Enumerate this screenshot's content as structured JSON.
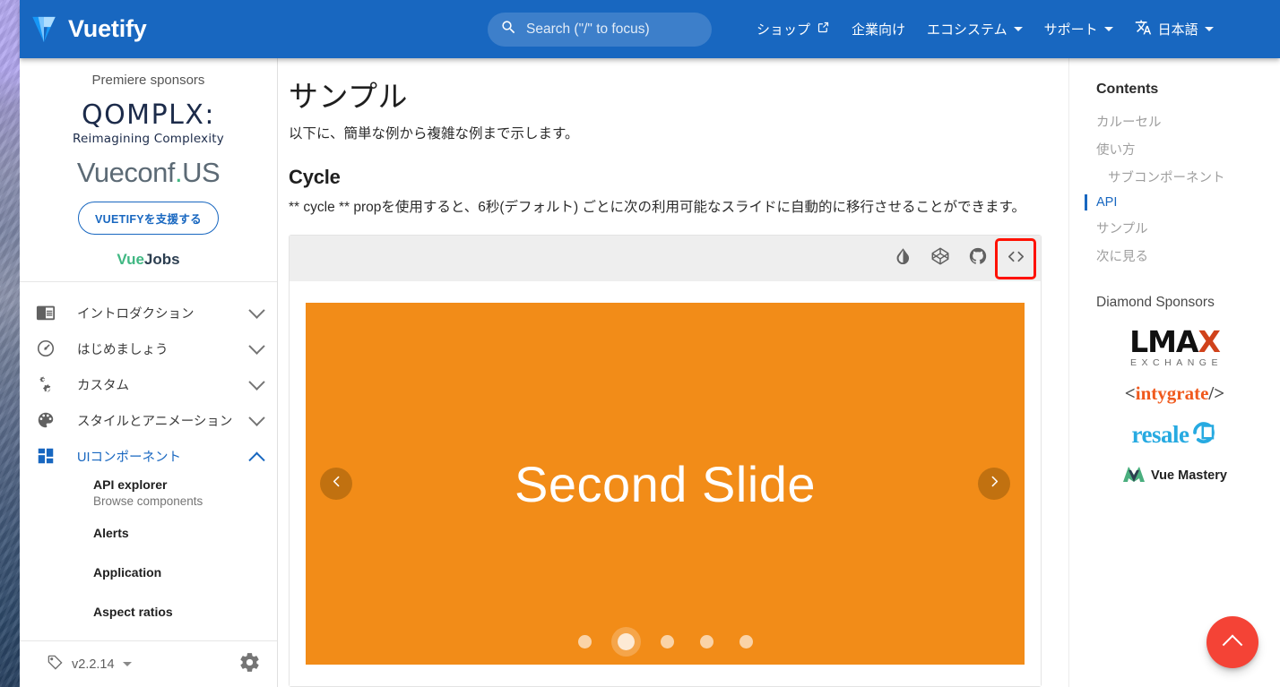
{
  "app": {
    "brand": "Vuetify",
    "brand_logo_icon": "vuetify-logo-icon"
  },
  "search": {
    "placeholder": "Search (\"/\" to focus)",
    "icon": "search-icon"
  },
  "nav": {
    "items": [
      {
        "label": "ショップ",
        "icon": "external-link-icon",
        "has_caret": false
      },
      {
        "label": "企業向け",
        "icon": null,
        "has_caret": false
      },
      {
        "label": "エコシステム",
        "icon": null,
        "has_caret": true
      },
      {
        "label": "サポート",
        "icon": null,
        "has_caret": true
      },
      {
        "label": "日本語",
        "icon": "translate-icon",
        "has_caret": true
      }
    ]
  },
  "sidebar": {
    "sponsors_title": "Premiere sponsors",
    "qomplx": {
      "name": "QOMPLX:",
      "tagline": "Reimagining Complexity"
    },
    "vueconf": {
      "pre": "Vueconf",
      "dot": ".",
      "post": "US"
    },
    "support_button": "VUETIFYを支援する",
    "vuejobs": {
      "a": "Vue",
      "b": "Jobs"
    },
    "groups": [
      {
        "label": "イントロダクション",
        "icon": "book-open-icon",
        "expanded": false
      },
      {
        "label": "はじめましょう",
        "icon": "speedometer-icon",
        "expanded": false
      },
      {
        "label": "カスタム",
        "icon": "cogs-icon",
        "expanded": false
      },
      {
        "label": "スタイルとアニメーション",
        "icon": "palette-icon",
        "expanded": false
      },
      {
        "label": "UIコンポーネント",
        "icon": "view-dashboard-icon",
        "expanded": true
      }
    ],
    "sub_items": [
      {
        "title": "API explorer",
        "subtitle": "Browse components"
      },
      {
        "title": "Alerts",
        "subtitle": null
      },
      {
        "title": "Application",
        "subtitle": null
      },
      {
        "title": "Aspect ratios",
        "subtitle": null
      }
    ],
    "footer": {
      "version": "v2.2.14",
      "version_icon": "tag-icon",
      "settings_icon": "gear-icon"
    }
  },
  "main": {
    "page_title": "サンプル",
    "lede": "以下に、簡単な例から複雑な例まで示します。",
    "section_heading": "Cycle",
    "section_paragraph": "** cycle ** propを使用すると、6秒(デフォルト) ごとに次の利用可能なスライドに自動的に移行させることができます。",
    "example_toolbar": [
      {
        "name": "invert-colors-icon",
        "label": "Toggle theme"
      },
      {
        "name": "codepen-icon",
        "label": "Edit in Codepen"
      },
      {
        "name": "github-icon",
        "label": "View on GitHub"
      },
      {
        "name": "code-tags-icon",
        "label": "View source",
        "highlighted": true
      }
    ],
    "carousel": {
      "slide_title": "Second Slide",
      "background_color": "#f28c18",
      "prev_icon": "chevron-left-icon",
      "next_icon": "chevron-right-icon",
      "dot_count": 5,
      "active_dot_index": 1
    }
  },
  "toc": {
    "title": "Contents",
    "links": [
      {
        "label": "カルーセル",
        "indent": false,
        "active": false
      },
      {
        "label": "使い方",
        "indent": false,
        "active": false
      },
      {
        "label": "サブコンポーネント",
        "indent": true,
        "active": false
      },
      {
        "label": "API",
        "indent": false,
        "active": true
      },
      {
        "label": "サンプル",
        "indent": false,
        "active": false
      },
      {
        "label": "次に見る",
        "indent": false,
        "active": false
      }
    ],
    "diamond_title": "Diamond Sponsors",
    "sponsors": {
      "lmax": {
        "word": "LMA",
        "accent": "X",
        "sub": "EXCHANGE"
      },
      "intygrate": {
        "open": "<",
        "mid": "intygrate",
        "close": "/>"
      },
      "resale": {
        "text": "resale"
      },
      "vuemastery": {
        "text": "Vue Mastery"
      }
    }
  },
  "fab": {
    "icon": "chevron-up-icon",
    "color": "#f44336"
  },
  "colors": {
    "appbar": "#1867c0",
    "accent": "#1867c0",
    "carousel": "#f28c18",
    "fab": "#f44336",
    "highlight_box": "#ff1100"
  }
}
